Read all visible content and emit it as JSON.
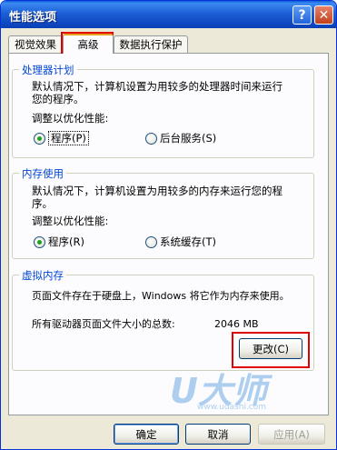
{
  "window": {
    "title": "性能选项",
    "help_label": "?",
    "close_label": "✕"
  },
  "tabs": [
    {
      "label": "视觉效果"
    },
    {
      "label": "高级"
    },
    {
      "label": "数据执行保护"
    }
  ],
  "processor": {
    "title": "处理器计划",
    "desc_line1": "默认情况下，计算机设置为用较多的处理器时间来运行",
    "desc_line2": "您的程序。",
    "adjust_label": "调整以优化性能:",
    "opt1": "程序(P)",
    "opt2": "后台服务(S)",
    "selected": "程序(P)"
  },
  "memory": {
    "title": "内存使用",
    "desc_line1": "默认情况下，计算机设置为用较多的内存来运行您的程",
    "desc_line2": "序。",
    "adjust_label": "调整以优化性能:",
    "opt1": "程序(R)",
    "opt2": "系统缓存(T)",
    "selected": "程序(R)"
  },
  "virtual_memory": {
    "title": "虚拟内存",
    "desc": "页面文件存在于硬盘上，Windows 将它作为内存来使用。",
    "total_label": "所有驱动器页面文件大小的总数:",
    "total_value": "2046 MB",
    "change_button": "更改(C)"
  },
  "buttons": {
    "ok": "确定",
    "cancel": "取消",
    "apply": "应用(A)"
  },
  "watermark": {
    "logo": "U大师",
    "url": "www.udashi.com"
  },
  "colors": {
    "titlebar": "#0a5bd7",
    "group_title": "#0046d5",
    "highlight_box": "#e10000",
    "radio_selected": "#21a121"
  }
}
